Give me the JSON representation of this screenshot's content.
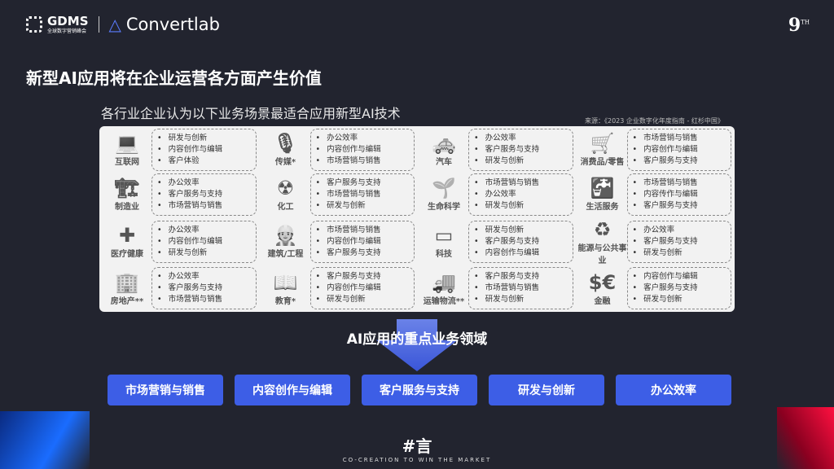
{
  "header": {
    "gdms": "GDMS",
    "gdms_sub": "全球数字营销峰会",
    "convertlab": "Convertlab",
    "edition": "9",
    "edition_sup": "TH"
  },
  "title": "新型AI应用将在企业运营各方面产生价值",
  "subtitle": "各行业企业认为以下业务场景最适合应用新型AI技术",
  "source": "来源：《2023 企业数字化年度指南 - 红杉中国》",
  "industries": [
    {
      "name": "互联网",
      "icon": "laptop-icon",
      "items": [
        "研发与创新",
        "内容创作与编辑",
        "客户体验"
      ]
    },
    {
      "name": "传媒*",
      "icon": "microphone-icon",
      "items": [
        "办公效率",
        "内容创作与编辑",
        "市场营销与销售"
      ]
    },
    {
      "name": "汽车",
      "icon": "car-icon",
      "items": [
        "办公效率",
        "客户服务与支持",
        "研发与创新"
      ]
    },
    {
      "name": "消费品/零售",
      "icon": "cart-icon",
      "items": [
        "市场营销与销售",
        "内容创作与编辑",
        "客户服务与支持"
      ]
    },
    {
      "name": "制造业",
      "icon": "crane-icon",
      "items": [
        "办公效率",
        "客户服务与支持",
        "市场营销与销售"
      ]
    },
    {
      "name": "化工",
      "icon": "radiation-icon",
      "items": [
        "客户服务与支持",
        "市场营销与销售",
        "研发与创新"
      ]
    },
    {
      "name": "生命科学",
      "icon": "plant-icon",
      "items": [
        "市场营销与销售",
        "办公效率",
        "研发与创新"
      ]
    },
    {
      "name": "生活服务",
      "icon": "faucet-icon",
      "items": [
        "市场营销与销售",
        "内容传作与编辑",
        "客户服务与支持"
      ]
    },
    {
      "name": "医疗健康",
      "icon": "medkit-icon",
      "items": [
        "办公效率",
        "内容创作与编辑",
        "研发与创新"
      ]
    },
    {
      "name": "建筑/工程",
      "icon": "worker-icon",
      "items": [
        "市场营销与销售",
        "内容创作与编辑",
        "客户服务与支持"
      ]
    },
    {
      "name": "科技",
      "icon": "tablet-icon",
      "items": [
        "研发与创新",
        "客户服务与支持",
        "内容创作与编辑"
      ]
    },
    {
      "name": "能源与公共事业",
      "icon": "recycle-icon",
      "items": [
        "办公效率",
        "客户服务与支持",
        "研发与创新"
      ]
    },
    {
      "name": "房地产**",
      "icon": "building-icon",
      "items": [
        "办公效率",
        "客户服务与支持",
        "市场营销与销售"
      ]
    },
    {
      "name": "教育*",
      "icon": "book-icon",
      "items": [
        "客户服务与支持",
        "内容创作与编辑",
        "研发与创新"
      ]
    },
    {
      "name": "运输物流**",
      "icon": "truck-icon",
      "items": [
        "客户服务与支持",
        "市场营销与销售",
        "研发与创新"
      ]
    },
    {
      "name": "金融",
      "icon": "currency-icon",
      "items": [
        "内容创作与编辑",
        "客户服务与支持",
        "研发与创新"
      ]
    }
  ],
  "focus_label": "AI应用的重点业务领域",
  "focus_areas": [
    "市场营销与销售",
    "内容创作与编辑",
    "客户服务与支持",
    "研发与创新",
    "办公效率"
  ],
  "footer": {
    "logo": "#言",
    "tagline": "CO-CREATION TO WIN THE MARKET"
  },
  "colors": {
    "accent": "#3d5ee6",
    "background": "#22242f"
  }
}
